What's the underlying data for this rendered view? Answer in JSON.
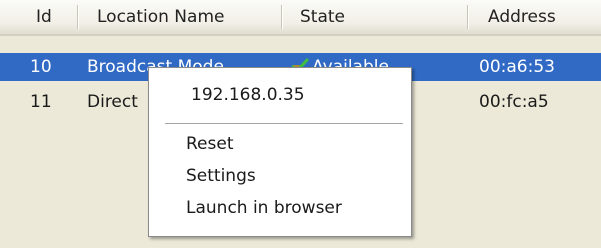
{
  "columns": [
    "Id",
    "Location Name",
    "State",
    "Address"
  ],
  "rows": [
    {
      "id": "10",
      "name": "Broadcast Mode",
      "state": "Available",
      "address": "00:a6:53",
      "selected": true
    },
    {
      "id": "11",
      "name": "Direct",
      "state": "",
      "address": "00:fc:a5",
      "selected": false
    }
  ],
  "context_menu": {
    "ip": "192.168.0.35",
    "items": [
      "Reset",
      "Settings",
      "Launch in browser"
    ]
  },
  "colors": {
    "selection": "#316ac5",
    "background": "#ece9d8"
  },
  "icons": {
    "state_available": "plug-check-icon"
  }
}
